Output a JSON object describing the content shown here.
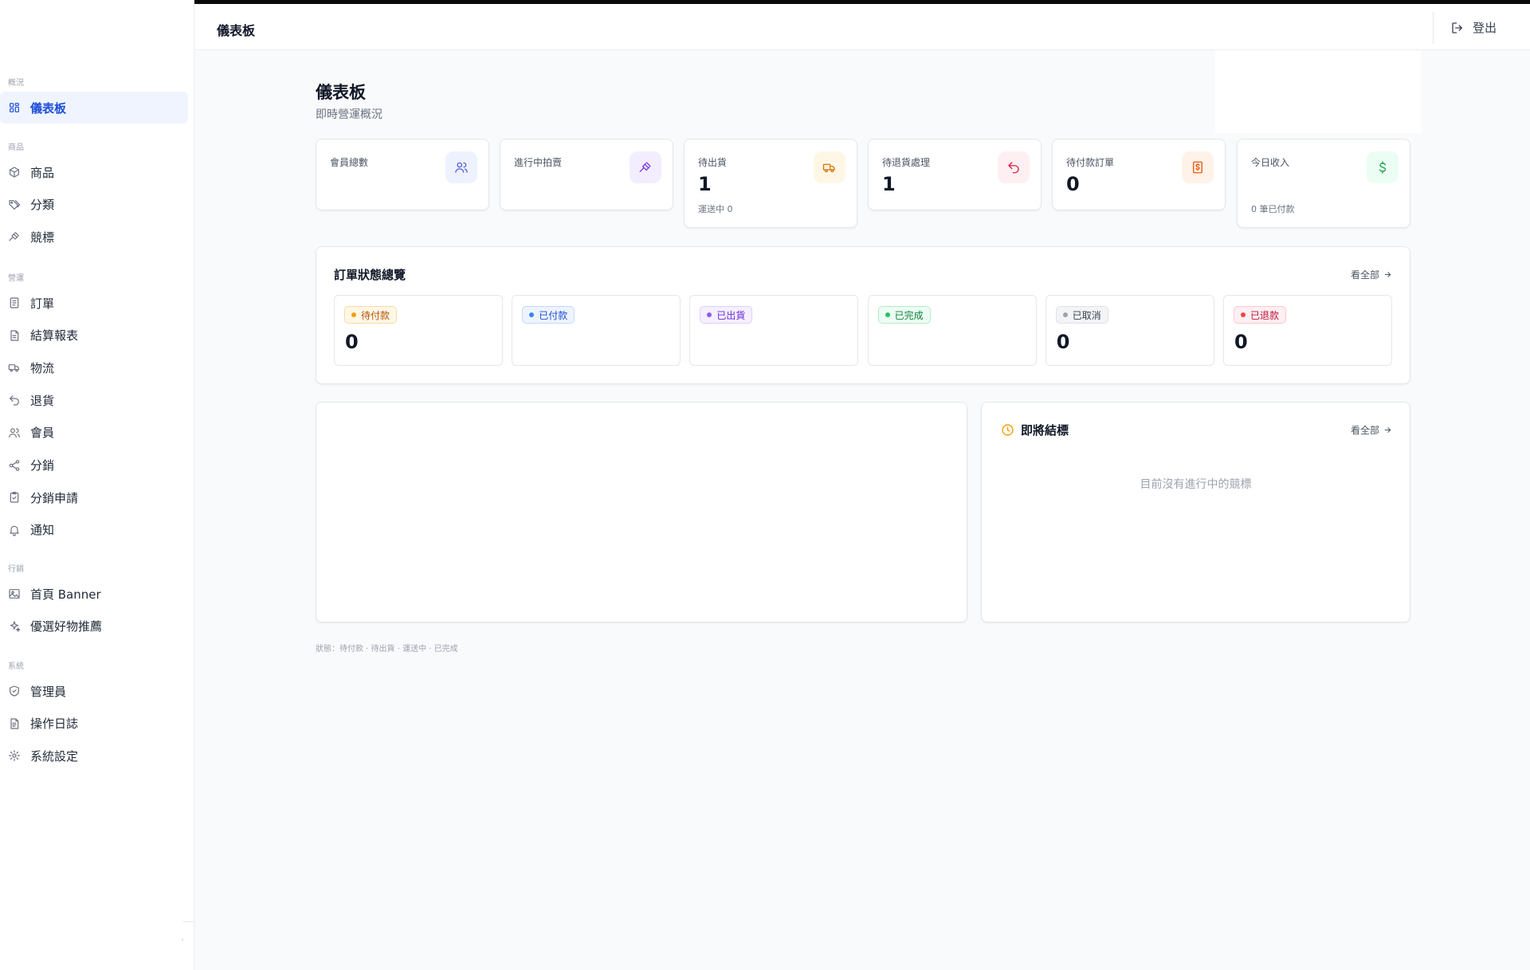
{
  "sidebar": {
    "sections": [
      {
        "title": "概況",
        "items": [
          {
            "label": "儀表板",
            "icon": "dashboard-grid-icon",
            "active": true
          }
        ]
      },
      {
        "title": "商品",
        "items": [
          {
            "label": "商品",
            "icon": "box-icon"
          },
          {
            "label": "分類",
            "icon": "tags-icon"
          },
          {
            "label": "競標",
            "icon": "gavel-icon"
          }
        ]
      },
      {
        "title": "營運",
        "items": [
          {
            "label": "訂單",
            "icon": "receipt-icon"
          },
          {
            "label": "結算報表",
            "icon": "report-icon"
          },
          {
            "label": "物流",
            "icon": "truck-icon"
          },
          {
            "label": "退貨",
            "icon": "undo-icon"
          },
          {
            "label": "會員",
            "icon": "users-icon"
          },
          {
            "label": "分銷",
            "icon": "share-icon"
          },
          {
            "label": "分銷申請",
            "icon": "clipboard-check-icon"
          },
          {
            "label": "通知",
            "icon": "bell-icon"
          }
        ]
      },
      {
        "title": "行銷",
        "items": [
          {
            "label": "首頁 Banner",
            "icon": "image-icon"
          },
          {
            "label": "優選好物推薦",
            "icon": "sparkles-icon"
          }
        ]
      },
      {
        "title": "系統",
        "items": [
          {
            "label": "管理員",
            "icon": "shield-icon"
          },
          {
            "label": "操作日誌",
            "icon": "log-icon"
          },
          {
            "label": "系統設定",
            "icon": "gear-icon"
          }
        ]
      }
    ]
  },
  "header": {
    "title": "儀表板",
    "logout_label": "登出"
  },
  "page": {
    "title": "儀表板",
    "subtitle": "即時營運概況"
  },
  "stats": [
    {
      "label": "會員總數",
      "value": "",
      "sub": "",
      "icon": "users-icon",
      "bg": "#eef2ff",
      "fg": "#4f5fd6"
    },
    {
      "label": "進行中拍賣",
      "value": "",
      "sub": "",
      "icon": "gavel-icon",
      "bg": "#f3eeff",
      "fg": "#7c3aed"
    },
    {
      "label": "待出貨",
      "value": "1",
      "sub": "運送中 0",
      "icon": "truck-icon",
      "bg": "#fff7e6",
      "fg": "#d97706"
    },
    {
      "label": "待退貨處理",
      "value": "1",
      "sub": "",
      "icon": "undo-icon",
      "bg": "#fef0f2",
      "fg": "#e11d48"
    },
    {
      "label": "待付款訂單",
      "value": "0",
      "sub": "",
      "icon": "bill-icon",
      "bg": "#fff2e8",
      "fg": "#ea580c"
    },
    {
      "label": "今日收入",
      "value": "",
      "sub": "0 筆已付款",
      "icon": "dollar-icon",
      "bg": "#ecfdf3",
      "fg": "#16a34a"
    }
  ],
  "order_overview": {
    "title": "訂單狀態總覽",
    "see_all": "看全部",
    "statuses": [
      {
        "label": "待付款",
        "count": "0",
        "bg": "#fff7e6",
        "border": "#fcd9a8",
        "fg": "#b45309",
        "dot": "#f59e0b"
      },
      {
        "label": "已付款",
        "count": "",
        "bg": "#eef4ff",
        "border": "#c7d7fe",
        "fg": "#1d4ed8",
        "dot": "#3b82f6"
      },
      {
        "label": "已出貨",
        "count": "",
        "bg": "#f5f0ff",
        "border": "#ddd0fe",
        "fg": "#6d28d9",
        "dot": "#8b5cf6"
      },
      {
        "label": "已完成",
        "count": "",
        "bg": "#ecfdf3",
        "border": "#b7ebcb",
        "fg": "#15803d",
        "dot": "#22c55e"
      },
      {
        "label": "已取消",
        "count": "0",
        "bg": "#f3f4f6",
        "border": "#e0e2e6",
        "fg": "#374151",
        "dot": "#9ca3af"
      },
      {
        "label": "已退款",
        "count": "0",
        "bg": "#fef0f2",
        "border": "#fbc8d0",
        "fg": "#be123c",
        "dot": "#ef4444"
      }
    ]
  },
  "ending_soon": {
    "title": "即將結標",
    "see_all": "看全部",
    "empty": "目前沒有進行中的競標"
  },
  "footnote": "狀態：待付款 · 待出貨 · 運送中 · 已完成"
}
